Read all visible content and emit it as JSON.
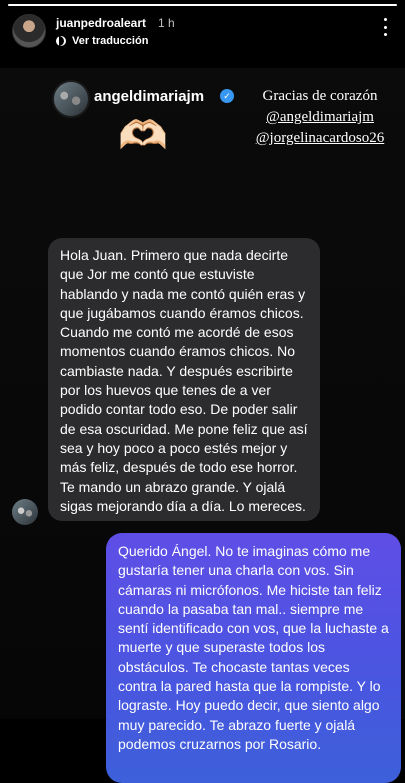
{
  "story": {
    "progress": 1.0,
    "author": "juanpedroaleart",
    "time": "1 h",
    "translate_label": "Ver traducción"
  },
  "post": {
    "username": "angeldimariajm",
    "emoji": "🫶🏻",
    "handwritten_lines": [
      "Gracias de corazón",
      "@angeldimariajm",
      "@jorgelinacardoso26"
    ],
    "received_message": "Hola Juan. Primero que nada decirte que Jor me contó que estuviste hablando y nada me contó quién eras y que jugábamos cuando éramos chicos. Cuando me contó me acordé de esos momentos cuando éramos chicos. No cambiaste nada. Y después escribirte por los huevos que tenes de a ver podido contar todo eso. De poder salir de esa oscuridad. Me pone feliz que así sea y hoy poco a poco estés mejor y más feliz, después de todo ese horror. Te mando un abrazo grande. Y ojalá sigas mejorando día a día. Lo mereces.",
    "sent_message": "Querido Ángel. No te imaginas cómo me gustaría tener una charla con vos. Sin cámaras ni micrófonos. Me hiciste tan feliz cuando la pasaba tan mal.. siempre me sentí identificado con vos, que la luchaste a muerte y que superaste todos los obstáculos. Te chocaste tantas veces contra la pared hasta que la rompiste. Y lo lograste. Hoy puedo decir, que siento algo muy parecido. Te abrazo fuerte y ojalá podemos cruzarnos por Rosario."
  },
  "colors": {
    "received_bubble": "#2c2c2e",
    "sent_bubble_top": "#5f4ee6",
    "sent_bubble_bottom": "#3d60da",
    "verified": "#3897f0"
  }
}
